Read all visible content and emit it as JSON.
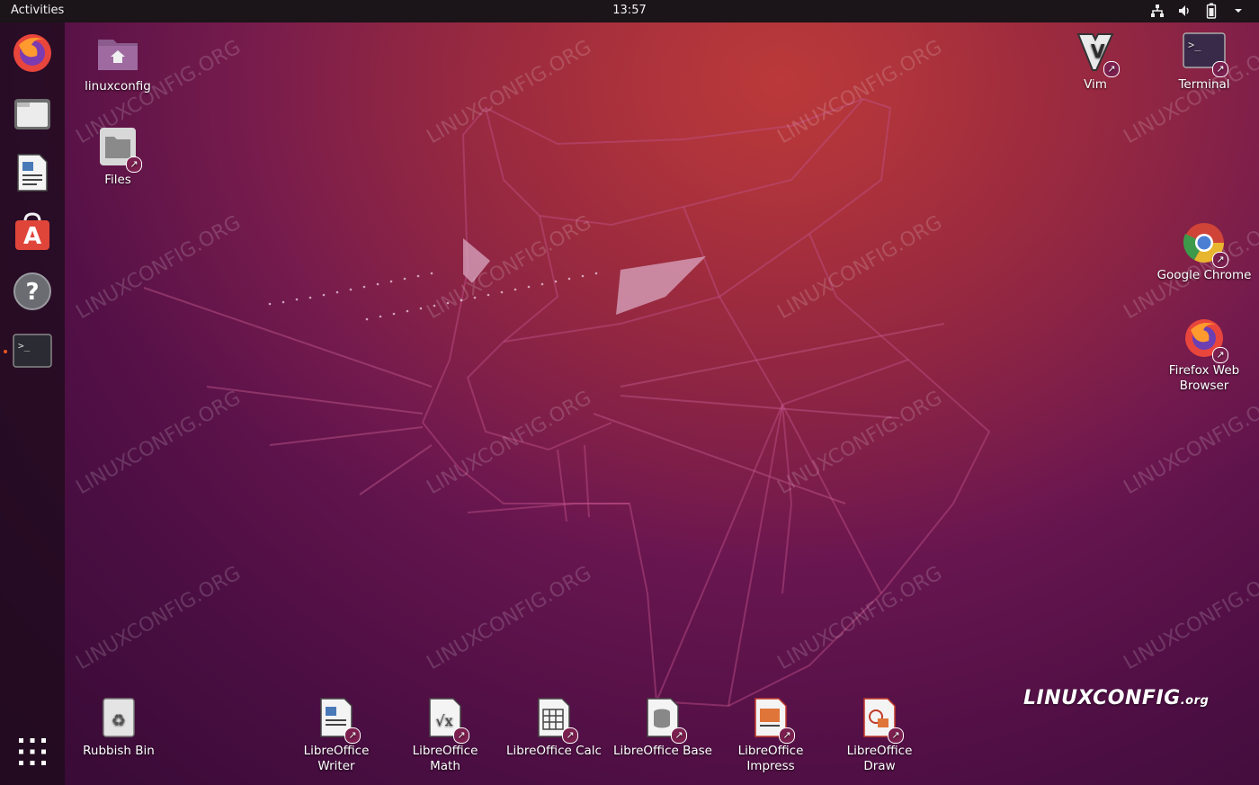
{
  "topbar": {
    "activities": "Activities",
    "clock": "13:57"
  },
  "tray": {
    "network_icon": "network-icon",
    "volume_icon": "volume-icon",
    "battery_icon": "battery-icon"
  },
  "dock": {
    "items": [
      {
        "name": "Firefox",
        "icon": "firefox-icon"
      },
      {
        "name": "Files",
        "icon": "files-icon"
      },
      {
        "name": "LibreOffice Writer",
        "icon": "writer-icon"
      },
      {
        "name": "Ubuntu Software",
        "icon": "software-icon"
      },
      {
        "name": "Help",
        "icon": "help-icon"
      },
      {
        "name": "Terminal",
        "icon": "terminal-icon",
        "running": true
      }
    ],
    "apps_grid_icon": "show-applications-icon"
  },
  "desktop": {
    "home": "linuxconfig",
    "files": "Files",
    "vim": "Vim",
    "terminal": "Terminal",
    "chrome": "Google Chrome",
    "firefox_line1": "Firefox Web",
    "firefox_line2": "Browser",
    "rubbish": "Rubbish Bin",
    "writer_line1": "LibreOffice",
    "writer_line2": "Writer",
    "math_line1": "LibreOffice",
    "math_line2": "Math",
    "calc": "LibreOffice Calc",
    "base": "LibreOffice Base",
    "impress_line1": "LibreOffice",
    "impress_line2": "Impress",
    "draw_line1": "LibreOffice",
    "draw_line2": "Draw"
  },
  "watermark": {
    "text": "LINUXCONFIG.ORG"
  },
  "brand": {
    "main": "LINUXCONFIG",
    "suffix": ".org"
  },
  "colors": {
    "accent": "#e95420",
    "panel": "#1b1418"
  }
}
